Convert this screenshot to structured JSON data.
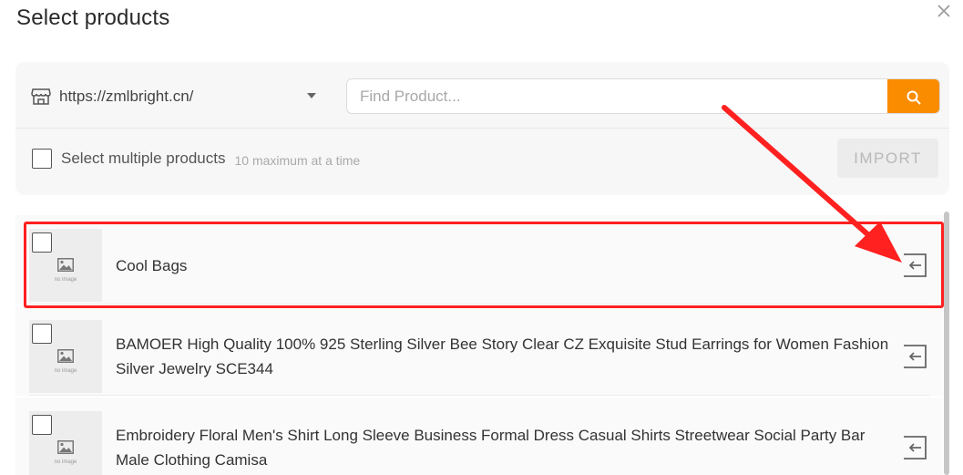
{
  "dialog": {
    "title": "Select products"
  },
  "toolbar": {
    "store_url": "https://zmlbright.cn/",
    "search_placeholder": "Find Product...",
    "multi_label": "Select multiple products",
    "multi_hint": "10 maximum at a time",
    "import_label": "IMPORT"
  },
  "products": [
    {
      "name": "Cool Bags",
      "thumb_text": "no image"
    },
    {
      "name": "BAMOER High Quality 100% 925 Sterling Silver Bee Story Clear CZ Exquisite Stud Earrings for Women Fashion Silver Jewelry SCE344",
      "thumb_text": "no image"
    },
    {
      "name": "Embroidery Floral Men's Shirt Long Sleeve Business Formal Dress Casual Shirts Streetwear Social Party Bar Male Clothing Camisa",
      "thumb_text": "no image"
    }
  ],
  "colors": {
    "accent": "#fa8c00",
    "highlight": "#ff2020"
  },
  "icons": {
    "close": "close-icon",
    "store": "store-icon",
    "search": "search-icon",
    "image_placeholder": "image-icon",
    "import": "import-icon"
  }
}
